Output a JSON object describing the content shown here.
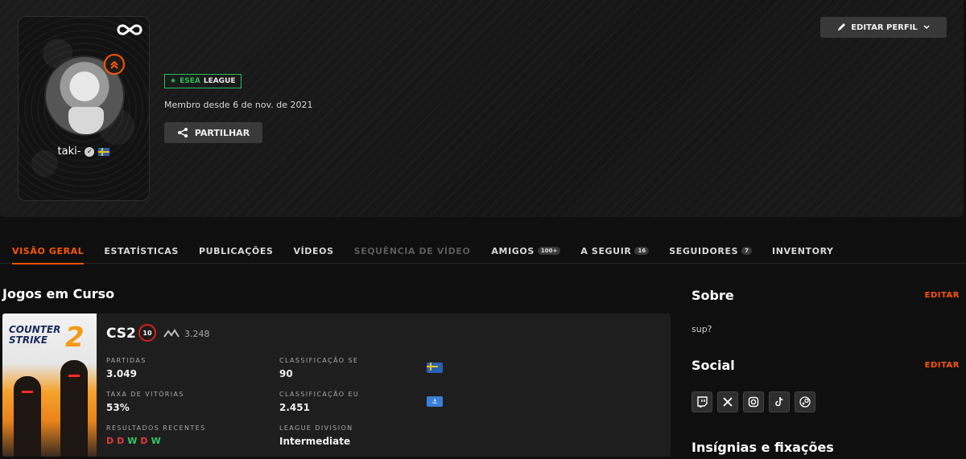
{
  "header": {
    "username": "taki-",
    "esea": {
      "brand": "ESEA",
      "label": "LEAGUE"
    },
    "member_since": "Membro desde 6 de nov. de 2021",
    "share_label": "PARTILHAR",
    "edit_profile_label": "EDITAR PERFIL",
    "level": 10
  },
  "tabs": [
    {
      "label": "VISÃO GERAL",
      "state": "active"
    },
    {
      "label": "ESTATÍSTICAS"
    },
    {
      "label": "PUBLICAÇÕES"
    },
    {
      "label": "VÍDEOS"
    },
    {
      "label": "SEQUÊNCIA DE VÍDEO",
      "state": "disabled"
    },
    {
      "label": "AMIGOS",
      "count": "100+"
    },
    {
      "label": "A SEGUIR",
      "count": "16"
    },
    {
      "label": "SEGUIDORES",
      "count": "7"
    },
    {
      "label": "INVENTORY"
    }
  ],
  "games": {
    "title": "Jogos em Curso",
    "card": {
      "art_text_1": "COUNTER",
      "art_text_2": "STRIKE",
      "art_number": "2",
      "name": "CS2",
      "skill_level": "10",
      "elo": "3.248",
      "matches_label": "PARTIDAS",
      "matches_value": "3.049",
      "rank_se_label": "CLASSIFICAÇÃO SE",
      "rank_se_value": "90",
      "winrate_label": "TAXA DE VITÓRIAS",
      "winrate_value": "53%",
      "rank_eu_label": "CLASSIFICAÇÃO EU",
      "rank_eu_value": "2.451",
      "recent_label": "RESULTADOS RECENTES",
      "recent_results": [
        "D",
        "D",
        "W",
        "D",
        "W"
      ],
      "division_label": "LEAGUE DIVISION",
      "division_value": "Intermediate"
    }
  },
  "sidebar": {
    "about_title": "Sobre",
    "about_edit": "EDITAR",
    "about_text": "sup?",
    "social_title": "Social",
    "social_edit": "EDITAR",
    "social_icons": [
      "twitch-icon",
      "x-icon",
      "instagram-icon",
      "tiktok-icon",
      "steam-icon"
    ],
    "badges_title": "Insígnias e fixações"
  },
  "colors": {
    "accent": "#ff5500",
    "win": "#3ac463",
    "loss": "#e23a3a",
    "esea": "#2bbd5b"
  }
}
